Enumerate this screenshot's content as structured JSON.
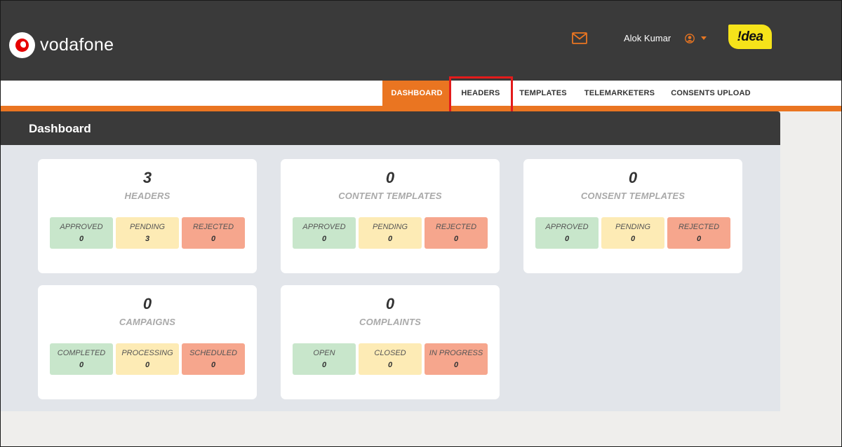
{
  "brand": {
    "name": "vodafone",
    "partner": "!dea"
  },
  "header": {
    "user_name": "Alok Kumar"
  },
  "nav": [
    {
      "label": "DASHBOARD",
      "active": true
    },
    {
      "label": "HEADERS",
      "active": false
    },
    {
      "label": "TEMPLATES",
      "active": false
    },
    {
      "label": "TELEMARKETERS",
      "active": false
    },
    {
      "label": "CONSENTS UPLOAD",
      "active": false
    }
  ],
  "page": {
    "title": "Dashboard"
  },
  "cards": [
    {
      "count": "3",
      "label": "HEADERS",
      "stats": [
        {
          "label": "APPROVED",
          "value": "0"
        },
        {
          "label": "PENDING",
          "value": "3"
        },
        {
          "label": "REJECTED",
          "value": "0"
        }
      ]
    },
    {
      "count": "0",
      "label": "CONTENT TEMPLATES",
      "stats": [
        {
          "label": "APPROVED",
          "value": "0"
        },
        {
          "label": "PENDING",
          "value": "0"
        },
        {
          "label": "REJECTED",
          "value": "0"
        }
      ]
    },
    {
      "count": "0",
      "label": "CONSENT TEMPLATES",
      "stats": [
        {
          "label": "APPROVED",
          "value": "0"
        },
        {
          "label": "PENDING",
          "value": "0"
        },
        {
          "label": "REJECTED",
          "value": "0"
        }
      ]
    },
    {
      "count": "0",
      "label": "CAMPAIGNS",
      "stats": [
        {
          "label": "COMPLETED",
          "value": "0"
        },
        {
          "label": "PROCESSING",
          "value": "0"
        },
        {
          "label": "SCHEDULED",
          "value": "0"
        }
      ]
    },
    {
      "count": "0",
      "label": "COMPLAINTS",
      "stats": [
        {
          "label": "OPEN",
          "value": "0"
        },
        {
          "label": "CLOSED",
          "value": "0"
        },
        {
          "label": "IN PROGRESS",
          "value": "0"
        }
      ]
    }
  ],
  "colors": {
    "accent": "#ea7521",
    "header_bg": "#3a3a3a",
    "highlight": "#e31b1b",
    "approved": "#c8e6cb",
    "pending": "#fdebb5",
    "rejected": "#f6a68d"
  },
  "icons": {
    "mail": "mail-icon",
    "user": "user-circle-icon",
    "caret": "caret-down-icon"
  }
}
